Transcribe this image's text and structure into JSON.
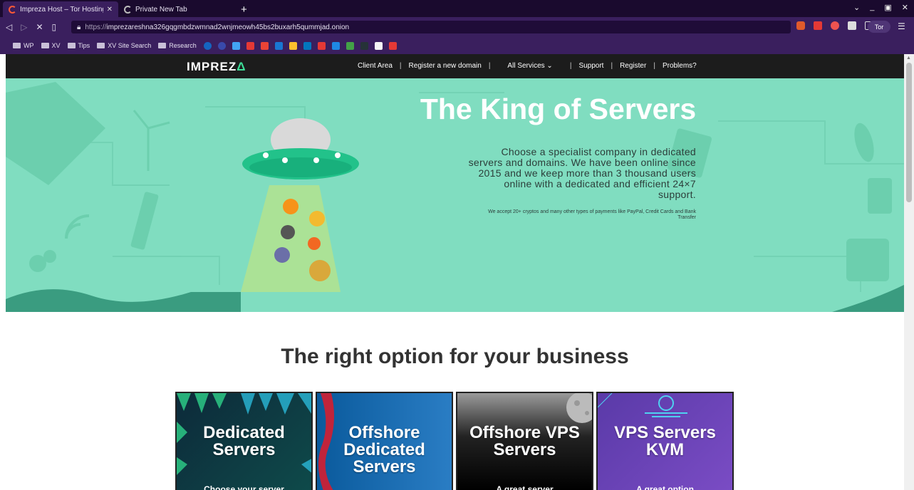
{
  "browser": {
    "tabs": [
      {
        "label": "Impreza Host – Tor Hosting |",
        "active": true
      },
      {
        "label": "Private New Tab",
        "active": false
      }
    ],
    "new_tab_glyph": "+",
    "url_proto": "https://",
    "url_host": "imprezareshna326gqgmbdzwmnad2wnjmeowh45bs2buxarh5qummjad.onion",
    "tor_label": "Tor",
    "bookmarks": [
      {
        "label": "WP",
        "type": "folder"
      },
      {
        "label": "XV",
        "type": "folder"
      },
      {
        "label": "Tips",
        "type": "folder"
      },
      {
        "label": "XV Site Search",
        "type": "folder"
      },
      {
        "label": "Research",
        "type": "folder"
      }
    ],
    "bookmark_favicons": [
      "#1565c0",
      "#3949ab",
      "#42a5f5",
      "#e53935",
      "#ea4335",
      "#1976d2",
      "#fbc02d",
      "#0277bd",
      "#e53935",
      "#1e88e5",
      "#43a047",
      "#263238",
      "#f5f5f5",
      "#e53935"
    ]
  },
  "site": {
    "logo": "IMPREZ",
    "logo_mark": "Δ",
    "nav": [
      "Client Area",
      "Register a new domain",
      "All Services ⌄",
      "Support",
      "Register",
      "Problems?"
    ],
    "hero": {
      "title": "The King of Servers",
      "description": "Choose a specialist company in dedicated servers and domains. We have been online since 2015 and we keep more than 3 thousand users online with a dedicated and efficient 24×7 support.",
      "note": "We accept 20+ cryptos and many other types of payments like PayPal, Credit Cards and Bank Transfer"
    },
    "section_title": "The right option for your business",
    "cards": [
      {
        "title": "Dedicated Servers",
        "subtitle": "Choose your server"
      },
      {
        "title": "Offshore Dedicated Servers",
        "subtitle": ""
      },
      {
        "title": "Offshore VPS Servers",
        "subtitle": "A great server"
      },
      {
        "title": "VPS Servers KVM",
        "subtitle": "A great option"
      }
    ]
  },
  "colors": {
    "hero_bg": "#80ddc0",
    "nav_bg": "#1c1c1c",
    "accent": "#3ddc97",
    "chrome": "#3a1f5e"
  }
}
